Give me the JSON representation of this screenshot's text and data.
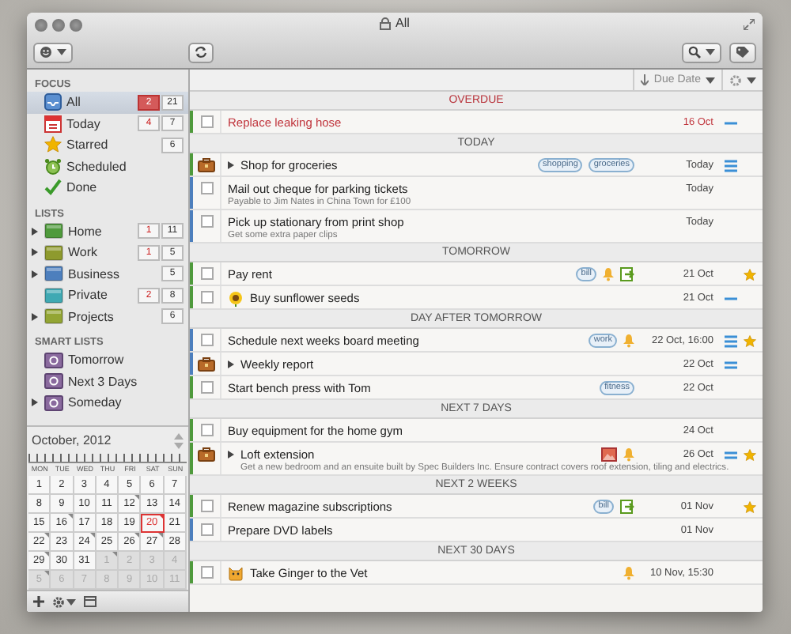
{
  "window": {
    "title": "All"
  },
  "sidebar": {
    "sections": [
      {
        "title": "FOCUS",
        "items": [
          {
            "label": "All",
            "kind": "inbox",
            "selected": true,
            "expandable": false,
            "overdue": "2",
            "total": "21"
          },
          {
            "label": "Today",
            "kind": "today",
            "selected": false,
            "expandable": false,
            "overdue": "4",
            "total": "7"
          },
          {
            "label": "Starred",
            "kind": "starred",
            "selected": false,
            "expandable": false,
            "total": "6"
          },
          {
            "label": "Scheduled",
            "kind": "scheduled",
            "selected": false,
            "expandable": false
          },
          {
            "label": "Done",
            "kind": "done",
            "selected": false,
            "expandable": false
          }
        ]
      },
      {
        "title": "LISTS",
        "items": [
          {
            "label": "Home",
            "kind": "list",
            "color": "#4f9a3c",
            "selected": false,
            "expandable": true,
            "overdue": "1",
            "total": "11"
          },
          {
            "label": "Work",
            "kind": "list",
            "color": "#8e9a2e",
            "selected": false,
            "expandable": true,
            "overdue": "1",
            "total": "5"
          },
          {
            "label": "Business",
            "kind": "list",
            "color": "#4d7fbd",
            "selected": false,
            "expandable": true,
            "total": "5"
          },
          {
            "label": "Private",
            "kind": "list",
            "color": "#3fa9b3",
            "selected": false,
            "expandable": false,
            "overdue": "2",
            "total": "8"
          },
          {
            "label": "Projects",
            "kind": "list",
            "color": "#93a534",
            "selected": false,
            "expandable": true,
            "total": "6"
          }
        ]
      },
      {
        "title": "SMART LISTS",
        "items": [
          {
            "label": "Tomorrow",
            "kind": "smart",
            "selected": false,
            "expandable": false
          },
          {
            "label": "Next 3 Days",
            "kind": "smart",
            "selected": false,
            "expandable": false
          },
          {
            "label": "Someday",
            "kind": "smart",
            "selected": false,
            "expandable": true
          }
        ]
      }
    ]
  },
  "calendar": {
    "month": "October, 2012",
    "day_names": [
      "MON",
      "TUE",
      "WED",
      "THU",
      "FRI",
      "SAT",
      "SUN"
    ],
    "weeks": [
      [
        {
          "day": "1",
          "other_month": false,
          "selected": false,
          "marked": false
        },
        {
          "day": "2",
          "other_month": false,
          "selected": false,
          "marked": false
        },
        {
          "day": "3",
          "other_month": false,
          "selected": false,
          "marked": false
        },
        {
          "day": "4",
          "other_month": false,
          "selected": false,
          "marked": false
        },
        {
          "day": "5",
          "other_month": false,
          "selected": false,
          "marked": false
        },
        {
          "day": "6",
          "other_month": false,
          "selected": false,
          "marked": false
        },
        {
          "day": "7",
          "other_month": false,
          "selected": false,
          "marked": false
        }
      ],
      [
        {
          "day": "8",
          "other_month": false,
          "selected": false,
          "marked": false
        },
        {
          "day": "9",
          "other_month": false,
          "selected": false,
          "marked": false
        },
        {
          "day": "10",
          "other_month": false,
          "selected": false,
          "marked": false
        },
        {
          "day": "11",
          "other_month": false,
          "selected": false,
          "marked": false
        },
        {
          "day": "12",
          "other_month": false,
          "selected": false,
          "marked": true
        },
        {
          "day": "13",
          "other_month": false,
          "selected": false,
          "marked": false
        },
        {
          "day": "14",
          "other_month": false,
          "selected": false,
          "marked": false
        }
      ],
      [
        {
          "day": "15",
          "other_month": false,
          "selected": false,
          "marked": false
        },
        {
          "day": "16",
          "other_month": false,
          "selected": false,
          "marked": true
        },
        {
          "day": "17",
          "other_month": false,
          "selected": false,
          "marked": false
        },
        {
          "day": "18",
          "other_month": false,
          "selected": false,
          "marked": false
        },
        {
          "day": "19",
          "other_month": false,
          "selected": false,
          "marked": false
        },
        {
          "day": "20",
          "other_month": false,
          "selected": true,
          "marked": true
        },
        {
          "day": "21",
          "other_month": false,
          "selected": false,
          "marked": false
        }
      ],
      [
        {
          "day": "22",
          "other_month": false,
          "selected": false,
          "marked": true
        },
        {
          "day": "23",
          "other_month": false,
          "selected": false,
          "marked": false
        },
        {
          "day": "24",
          "other_month": false,
          "selected": false,
          "marked": true
        },
        {
          "day": "25",
          "other_month": false,
          "selected": false,
          "marked": false
        },
        {
          "day": "26",
          "other_month": false,
          "selected": false,
          "marked": true
        },
        {
          "day": "27",
          "other_month": false,
          "selected": false,
          "marked": true
        },
        {
          "day": "28",
          "other_month": false,
          "selected": false,
          "marked": false
        }
      ],
      [
        {
          "day": "29",
          "other_month": false,
          "selected": false,
          "marked": true
        },
        {
          "day": "30",
          "other_month": false,
          "selected": false,
          "marked": false
        },
        {
          "day": "31",
          "other_month": false,
          "selected": false,
          "marked": false
        },
        {
          "day": "1",
          "other_month": true,
          "selected": false,
          "marked": true
        },
        {
          "day": "2",
          "other_month": true,
          "selected": false,
          "marked": false
        },
        {
          "day": "3",
          "other_month": true,
          "selected": false,
          "marked": false
        },
        {
          "day": "4",
          "other_month": true,
          "selected": false,
          "marked": false
        }
      ],
      [
        {
          "day": "5",
          "other_month": true,
          "selected": false,
          "marked": true
        },
        {
          "day": "6",
          "other_month": true,
          "selected": false,
          "marked": false
        },
        {
          "day": "7",
          "other_month": true,
          "selected": false,
          "marked": false
        },
        {
          "day": "8",
          "other_month": true,
          "selected": false,
          "marked": false
        },
        {
          "day": "9",
          "other_month": true,
          "selected": false,
          "marked": false
        },
        {
          "day": "10",
          "other_month": true,
          "selected": false,
          "marked": false
        },
        {
          "day": "11",
          "other_month": true,
          "selected": false,
          "marked": false
        }
      ]
    ]
  },
  "sort": {
    "label": "Due Date"
  },
  "groups": [
    {
      "title": "OVERDUE",
      "tasks": [
        {
          "kind": "task",
          "title": "Replace leaking hose",
          "color": "#4f9a3c",
          "overdue": true,
          "expandable": false,
          "due": "16 Oct",
          "priority": {
            "kind": "low"
          },
          "starred": false
        }
      ]
    },
    {
      "title": "TODAY",
      "tasks": [
        {
          "kind": "project",
          "title": "Shop for groceries",
          "color": "#4f9a3c",
          "overdue": false,
          "expandable": true,
          "tags": [
            "shopping",
            "groceries"
          ],
          "due": "Today",
          "priority": {
            "kind": "high"
          },
          "starred": false
        },
        {
          "kind": "task",
          "title": "Mail out cheque for parking tickets",
          "note": "Payable to Jim Nates in China Town for £100",
          "color": "#4d7fbd",
          "overdue": false,
          "expandable": false,
          "due": "Today",
          "starred": false
        },
        {
          "kind": "task",
          "title": "Pick up stationary from print shop",
          "note": "Get some extra paper clips",
          "color": "#4d7fbd",
          "overdue": false,
          "expandable": false,
          "due": "Today",
          "starred": false
        }
      ]
    },
    {
      "title": "TOMORROW",
      "tasks": [
        {
          "kind": "task",
          "title": "Pay rent",
          "color": "#4f9a3c",
          "overdue": false,
          "expandable": false,
          "tags": [
            "bill"
          ],
          "badges": [
            {
              "kind": "alarm"
            },
            {
              "kind": "repeat"
            }
          ],
          "due": "21 Oct",
          "starred": true
        },
        {
          "kind": "task",
          "title": "Buy sunflower seeds",
          "leading_icon": {
            "kind": "flower"
          },
          "color": "#4f9a3c",
          "overdue": false,
          "expandable": false,
          "due": "21 Oct",
          "priority": {
            "kind": "low"
          },
          "starred": false
        }
      ]
    },
    {
      "title": "DAY AFTER TOMORROW",
      "tasks": [
        {
          "kind": "task",
          "title": "Schedule next weeks board meeting",
          "color": "#4d7fbd",
          "overdue": false,
          "expandable": false,
          "tags": [
            "work"
          ],
          "badges": [
            {
              "kind": "alarm"
            }
          ],
          "due": "22 Oct, 16:00",
          "priority": {
            "kind": "high"
          },
          "starred": true
        },
        {
          "kind": "project",
          "title": "Weekly report",
          "color": "#4d7fbd",
          "overdue": false,
          "expandable": true,
          "due": "22 Oct",
          "priority": {
            "kind": "medium"
          },
          "starred": false
        },
        {
          "kind": "task",
          "title": "Start bench press with Tom",
          "color": "#4f9a3c",
          "overdue": false,
          "expandable": false,
          "tags": [
            "fitness"
          ],
          "due": "22 Oct",
          "starred": false
        }
      ]
    },
    {
      "title": "NEXT 7 DAYS",
      "tasks": [
        {
          "kind": "task",
          "title": "Buy equipment for the home gym",
          "color": "#4f9a3c",
          "overdue": false,
          "expandable": false,
          "due": "24 Oct",
          "starred": false
        },
        {
          "kind": "project",
          "title": "Loft extension",
          "note": "Get a new bedroom and an ensuite built by Spec Builders Inc. Ensure contract covers roof extension, tiling and electrics.",
          "color": "#4f9a3c",
          "overdue": false,
          "expandable": true,
          "badges": [
            {
              "kind": "photo"
            },
            {
              "kind": "alarm"
            }
          ],
          "due": "26 Oct",
          "priority": {
            "kind": "medium"
          },
          "starred": true
        }
      ]
    },
    {
      "title": "NEXT 2 WEEKS",
      "tasks": [
        {
          "kind": "task",
          "title": "Renew magazine subscriptions",
          "color": "#4f9a3c",
          "overdue": false,
          "expandable": false,
          "tags": [
            "bill"
          ],
          "badges": [
            {
              "kind": "repeat"
            }
          ],
          "due": "01 Nov",
          "starred": true
        },
        {
          "kind": "task",
          "title": "Prepare DVD labels",
          "color": "#4d7fbd",
          "overdue": false,
          "expandable": false,
          "due": "01 Nov",
          "starred": false
        }
      ]
    },
    {
      "title": "NEXT 30 DAYS",
      "tasks": [
        {
          "kind": "task",
          "title": "Take Ginger to the Vet",
          "leading_icon": {
            "kind": "cat"
          },
          "color": "#4f9a3c",
          "overdue": false,
          "expandable": false,
          "badges": [
            {
              "kind": "alarm"
            }
          ],
          "due": "10 Nov, 15:30",
          "starred": false
        }
      ]
    }
  ]
}
